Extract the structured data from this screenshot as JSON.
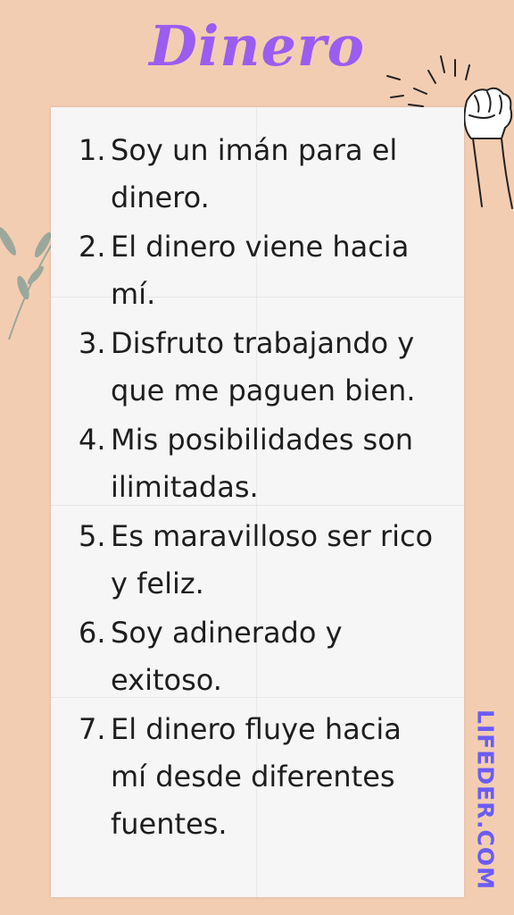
{
  "title": "Dinero",
  "brand": "LIFEDER.COM",
  "items": [
    {
      "num": "1.",
      "text": "Soy un imán para el dinero."
    },
    {
      "num": "2.",
      "text": "El dinero viene hacia mí."
    },
    {
      "num": "3.",
      "text": "Disfruto trabajando y que me paguen bien."
    },
    {
      "num": "4.",
      "text": "Mis posibilidades son ilimitadas."
    },
    {
      "num": "5.",
      "text": "Es maravilloso ser rico y feliz."
    },
    {
      "num": "6.",
      "text": "Soy adinerado y exitoso."
    },
    {
      "num": "7.",
      "text": "El dinero fluye hacia mí desde diferentes fuentes."
    }
  ],
  "colors": {
    "background": "#f3cdb2",
    "title": "#9b5cf0",
    "brand": "#6a5cf5",
    "paper": "#f6f6f7"
  },
  "icons": [
    "raised-fist-icon",
    "leaf-branch-icon"
  ]
}
